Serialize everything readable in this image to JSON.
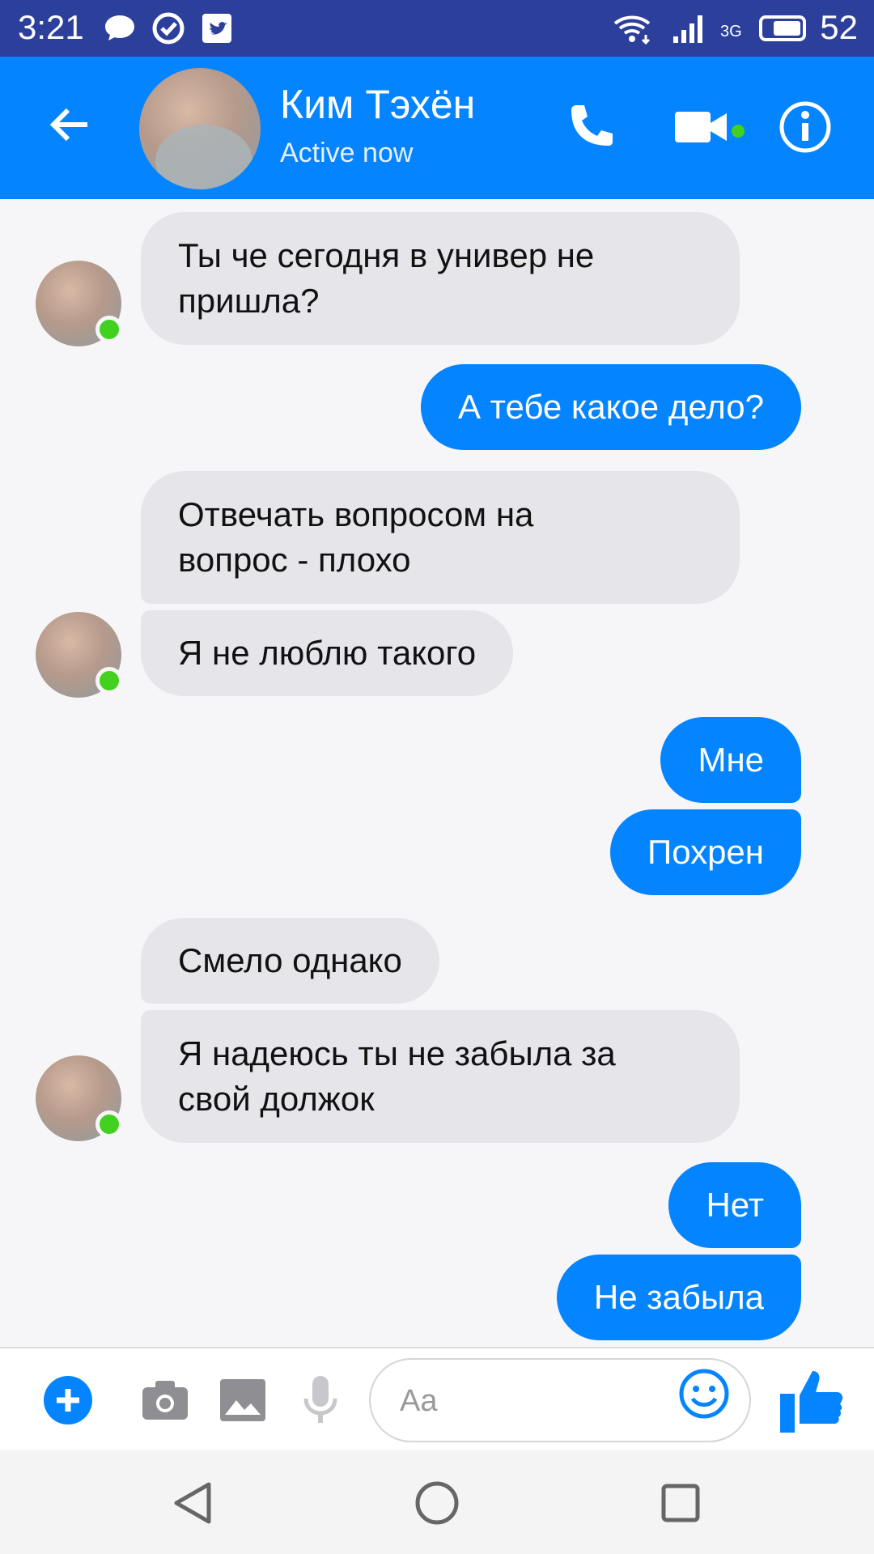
{
  "status_bar": {
    "time": "3:21",
    "network": "3G",
    "battery": "52"
  },
  "header": {
    "contact_name": "Ким Тэхён",
    "status": "Active now"
  },
  "messages": [
    {
      "side": "in",
      "text": "Ты че сегодня в универ не пришла?",
      "lines": [
        "Ты че сегодня в универ не",
        "пришла?"
      ]
    },
    {
      "side": "out",
      "text": "А тебе какое дело?"
    },
    {
      "side": "in",
      "lines": [
        "Отвечать вопросом на",
        "вопрос - плохо"
      ]
    },
    {
      "side": "in",
      "text": "Я не люблю такого"
    },
    {
      "side": "out",
      "text": "Мне"
    },
    {
      "side": "out",
      "text": "Похрен"
    },
    {
      "side": "in",
      "text": "Смело однако"
    },
    {
      "side": "in",
      "lines": [
        "Я надеюсь ты не забыла за",
        "свой должок"
      ]
    },
    {
      "side": "out",
      "text": "Нет"
    },
    {
      "side": "out",
      "text": "Не забыла"
    }
  ],
  "composer": {
    "placeholder": "Aa"
  },
  "colors": {
    "accent": "#0584ff",
    "status_bar": "#2c3f9b",
    "incoming_bubble": "#e6e6ea",
    "online": "#42d11f"
  }
}
